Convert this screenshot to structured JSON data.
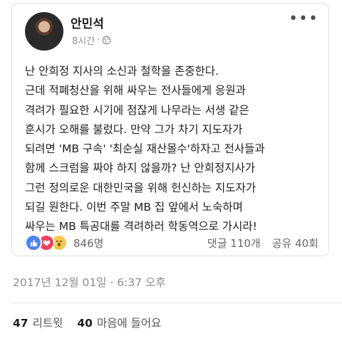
{
  "post": {
    "author": "안민석",
    "time": "8시간",
    "privacy_sep": "·",
    "more": "•••",
    "lines": [
      "난 안희정 지사의 소신과 철학을 존중한다.",
      "근데 적폐청산을 위해 싸우는 전사들에게 응원과",
      "격려가 필요한 시기에 점잖게 나무라는 서생 같은",
      "훈시가 오해를 불렀다. 만약 그가 차기 지도자가",
      "되려면 'MB 구속' '최순실 재산몰수'하자고 전사들과",
      "함께 스크럼을 짜야 하지 않을까? 난 안희정지사가",
      "그런 정의로운 대한민국을 위해 헌신하는 지도자가",
      "되길 원한다. 이번 주말 MB 집 앞에서 노숙하며",
      "싸우는 MB 특공대를 격려하러 학동역으로 가시라!"
    ],
    "reaction_count": "846명",
    "comments": "댓글 110개",
    "shares": "공유 40회",
    "icons": [
      "like-icon",
      "love-icon",
      "wow-icon",
      "globe-icon",
      "more-icon"
    ]
  },
  "tweet": {
    "timestamp": "2017년 12월 01일 · 6:37 오후",
    "retweet_count": "47",
    "retweet_label": "리트윗",
    "like_count": "40",
    "like_label": "마음에 들어요"
  },
  "colors": {
    "like": "#4c82f7",
    "love": "#f0405c",
    "wow": "#f7c948",
    "meta": "#90949c"
  }
}
